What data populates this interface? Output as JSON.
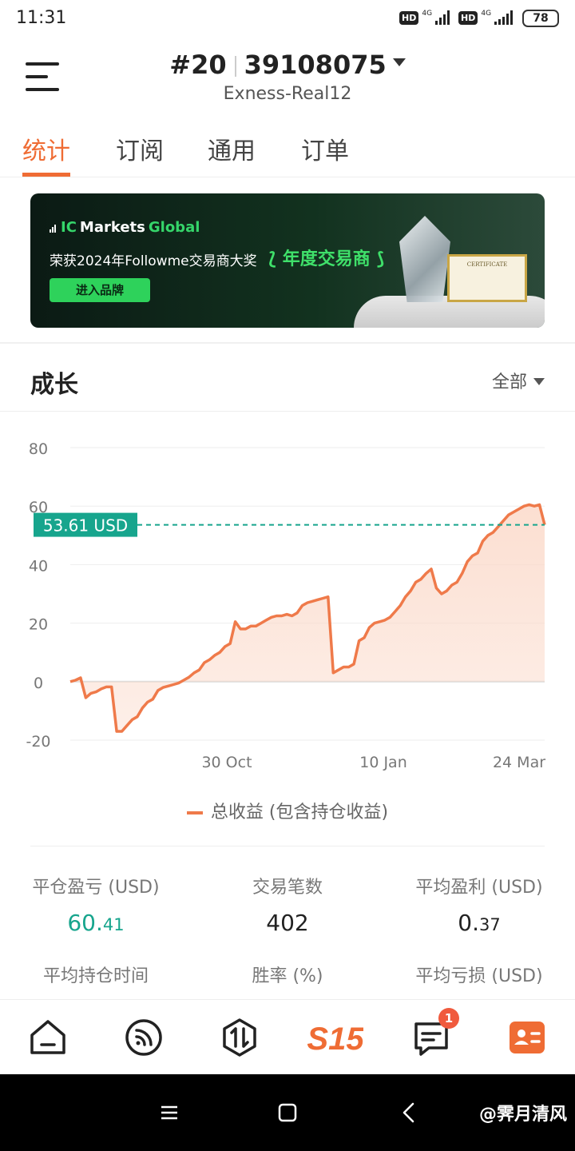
{
  "status_bar": {
    "time": "11:31",
    "hd1": "HD",
    "hd2": "HD",
    "net1": "4G",
    "net2": "4G",
    "battery": "78"
  },
  "header": {
    "rank": "#20",
    "account": "39108075",
    "server": "Exness-Real12"
  },
  "tabs": [
    {
      "label": "统计"
    },
    {
      "label": "订阅"
    },
    {
      "label": "通用"
    },
    {
      "label": "订单"
    }
  ],
  "banner": {
    "brand_ic": "IC",
    "brand_markets": "Markets",
    "brand_global": "Global",
    "award_text": "荣获2024年Followme交易商大奖",
    "award_highlight": "年度交易商",
    "button": "进入品牌",
    "certificate": "CERTIFICATE"
  },
  "growth": {
    "title": "成长",
    "range": "全部"
  },
  "chart_data": {
    "type": "area",
    "y_ticks": [
      "80",
      "60",
      "40",
      "20",
      "0",
      "-20"
    ],
    "ylim": [
      -20,
      80
    ],
    "x_ticks": [
      "30 Oct",
      "10 Jan",
      "24 Mar"
    ],
    "current_label": "53.61 USD",
    "current_value": 53.61,
    "legend": "总收益 (包含持仓收益)",
    "series": [
      {
        "values": [
          0,
          0.5,
          1.3,
          -5.5,
          -4,
          -3.5,
          -2.5,
          -1.8,
          -1.8,
          -17,
          -17,
          -15,
          -13,
          -12,
          -9,
          -7,
          -6,
          -3,
          -2,
          -1.5,
          -1,
          -0.5,
          0.5,
          1.5,
          3,
          4,
          6.5,
          7.5,
          9,
          10,
          12,
          13,
          20.5,
          18,
          18,
          19,
          19,
          20,
          21,
          22,
          22.5,
          22.5,
          23,
          22.5,
          23.5,
          26,
          27,
          27.5,
          28,
          28.5,
          29,
          3,
          4,
          5,
          5,
          6,
          14,
          15,
          18.5,
          20,
          20.5,
          21,
          22,
          24,
          26,
          29,
          31,
          34,
          35,
          37,
          38.5,
          32,
          30,
          31,
          33,
          34,
          37,
          41,
          43,
          44,
          48,
          50,
          51,
          53,
          55,
          57,
          58,
          59,
          60,
          60.5,
          60,
          60.5,
          53.6
        ]
      }
    ]
  },
  "stats": {
    "row1": [
      {
        "label": "平仓盈亏 (USD)",
        "value_main": "60.",
        "value_small": "41"
      },
      {
        "label": "交易笔数",
        "value_main": "402",
        "value_small": ""
      },
      {
        "label": "平均盈利 (USD)",
        "value_main": "0.",
        "value_small": "37"
      }
    ],
    "row2": [
      {
        "label": "平均持仓时间"
      },
      {
        "label": "胜率 (%)"
      },
      {
        "label": "平均亏损 (USD)"
      }
    ]
  },
  "bottom_nav": {
    "items": [
      {
        "icon": "home-icon"
      },
      {
        "icon": "feed-icon"
      },
      {
        "icon": "trade-icon"
      },
      {
        "icon": "s15-logo",
        "label": "S15"
      },
      {
        "icon": "message-icon",
        "badge": "1"
      },
      {
        "icon": "profile-card-icon"
      }
    ]
  },
  "watermark": "@霁月清风",
  "colors": {
    "accent": "#ef6c34",
    "positive": "#17a58d",
    "line": "#ef7a4a",
    "fill": "#fbd9c9",
    "badge": "#f05a3d"
  }
}
